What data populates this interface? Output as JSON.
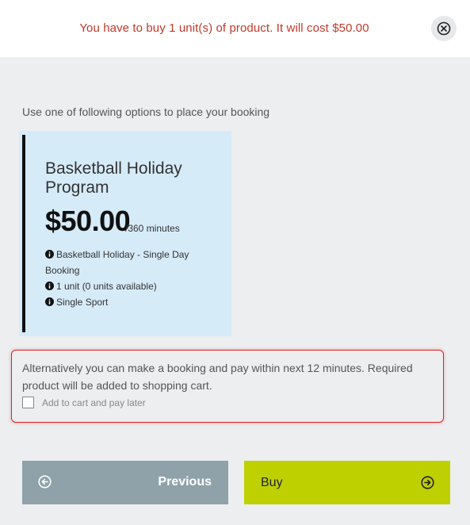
{
  "header": {
    "message": "You have to buy 1 unit(s) of product. It will cost $50.00",
    "close_icon": "close-circle-icon"
  },
  "intro": {
    "text": "Use one of following options to place your booking"
  },
  "product_card": {
    "title": "Basketball Holiday Program",
    "price": "$50.00",
    "per": "/360 minutes",
    "details": [
      "Basketball Holiday - Single Day Booking",
      "1 unit (0 units available)",
      "Single Sport"
    ],
    "detail_icon": "info-icon"
  },
  "alternative": {
    "text": "Alternatively you can make a booking and pay within next 12 minutes. Required product will be added to shopping cart.",
    "checkbox_label": "Add to cart and pay later",
    "checked": false
  },
  "footer": {
    "previous_label": "Previous",
    "previous_icon": "arrow-left-circle-icon",
    "buy_label": "Buy",
    "buy_icon": "arrow-right-circle-icon"
  },
  "colors": {
    "message": "#c0392b",
    "card_bg": "#d6ebf8",
    "highlight_border": "#e02020",
    "previous_bg": "#8fa2aa",
    "buy_bg": "#bfd000"
  }
}
